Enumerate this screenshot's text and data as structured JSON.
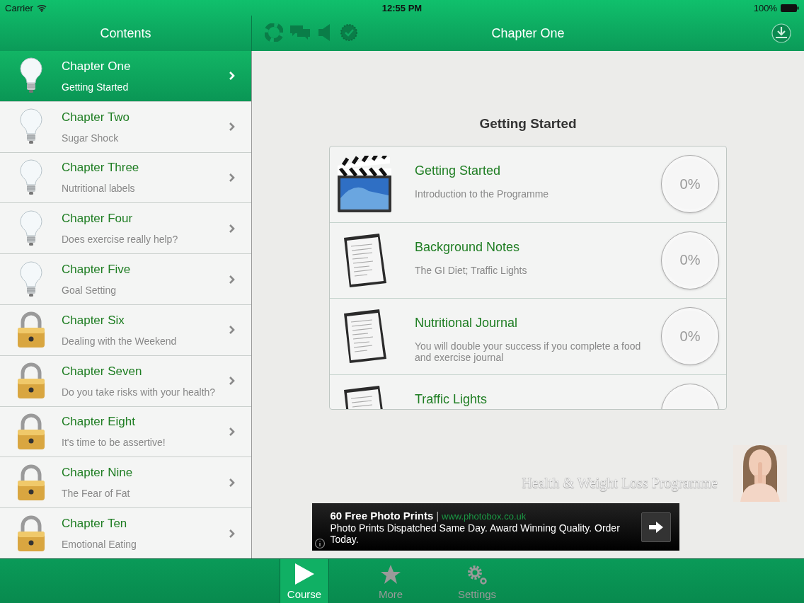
{
  "status_bar": {
    "carrier": "Carrier",
    "time": "12:55 PM",
    "battery": "100%"
  },
  "sidebar": {
    "title": "Contents",
    "chapters": [
      {
        "title": "Chapter One",
        "subtitle": "Getting Started",
        "locked": false,
        "selected": true
      },
      {
        "title": "Chapter Two",
        "subtitle": "Sugar Shock",
        "locked": false,
        "selected": false
      },
      {
        "title": "Chapter Three",
        "subtitle": "Nutritional labels",
        "locked": false,
        "selected": false
      },
      {
        "title": "Chapter Four",
        "subtitle": "Does exercise really help?",
        "locked": false,
        "selected": false
      },
      {
        "title": "Chapter Five",
        "subtitle": "Goal Setting",
        "locked": false,
        "selected": false
      },
      {
        "title": "Chapter Six",
        "subtitle": "Dealing with the Weekend",
        "locked": true,
        "selected": false
      },
      {
        "title": "Chapter Seven",
        "subtitle": "Do you take risks with your health?",
        "locked": true,
        "selected": false
      },
      {
        "title": "Chapter Eight",
        "subtitle": "It's time to be assertive!",
        "locked": true,
        "selected": false
      },
      {
        "title": "Chapter Nine",
        "subtitle": "The Fear of Fat",
        "locked": true,
        "selected": false
      },
      {
        "title": "Chapter Ten",
        "subtitle": "Emotional Eating",
        "locked": true,
        "selected": false
      }
    ]
  },
  "main": {
    "title": "Chapter One",
    "heading": "Getting Started",
    "lessons": [
      {
        "kind": "video",
        "title": "Getting Started",
        "subtitle": "Introduction to the Programme",
        "progress": "0%"
      },
      {
        "kind": "document",
        "title": "Background Notes",
        "subtitle": "The GI Diet; Traffic Lights",
        "progress": "0%"
      },
      {
        "kind": "document",
        "title": "Nutritional Journal",
        "subtitle": "You will double your success if you complete a food and exercise journal",
        "progress": "0%"
      },
      {
        "kind": "document",
        "title": "Traffic Lights"
      }
    ],
    "tagline": "Health & Weight Loss Programme",
    "ad": {
      "headline": "60 Free Photo Prints",
      "separator": "|",
      "url": "www.photobox.co.uk",
      "body": "Photo Prints Dispatched Same Day. Award Winning Quality. Order Today."
    }
  },
  "tab_bar": [
    {
      "label": "Course",
      "kind": "play",
      "selected": true
    },
    {
      "label": "More",
      "kind": "star",
      "selected": false
    },
    {
      "label": "Settings",
      "kind": "gear",
      "selected": false
    }
  ]
}
